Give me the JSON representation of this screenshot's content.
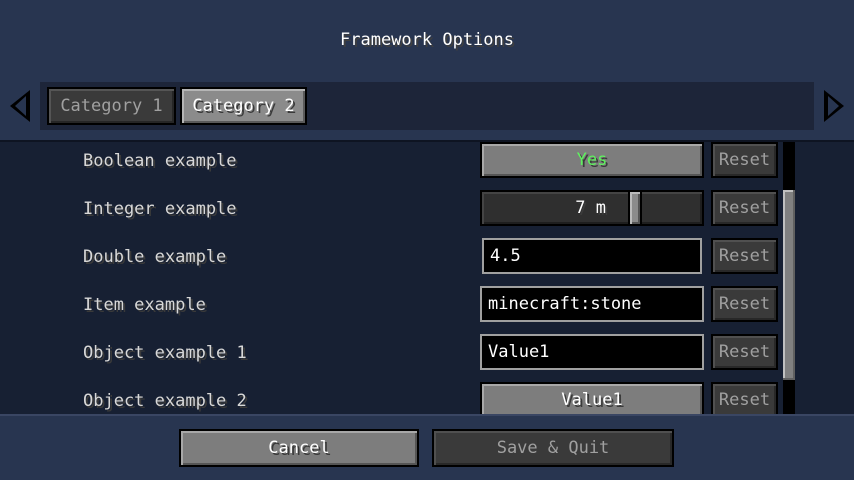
{
  "title": "Framework Options",
  "tabs": [
    {
      "label": "Category 1",
      "active": false
    },
    {
      "label": "Category 2",
      "active": true
    }
  ],
  "nav": {
    "prev_icon": "arrow-left-icon",
    "next_icon": "arrow-right-icon"
  },
  "options": [
    {
      "label": "Boolean example",
      "value": "Yes",
      "reset": "Reset"
    },
    {
      "label": "Integer example",
      "value": "7 m",
      "reset": "Reset"
    },
    {
      "label": "Double example",
      "value": "4.5",
      "reset": "Reset"
    },
    {
      "label": "Item example",
      "value": "minecraft:stone",
      "reset": "Reset"
    },
    {
      "label": "Object example 1",
      "value": "Value1",
      "reset": "Reset"
    },
    {
      "label": "Object example 2",
      "value": "Value1",
      "reset": "Reset"
    }
  ],
  "footer": {
    "cancel": "Cancel",
    "save": "Save & Quit"
  },
  "colors": {
    "background": "#283550",
    "boolean_true": "#5ef25e"
  }
}
